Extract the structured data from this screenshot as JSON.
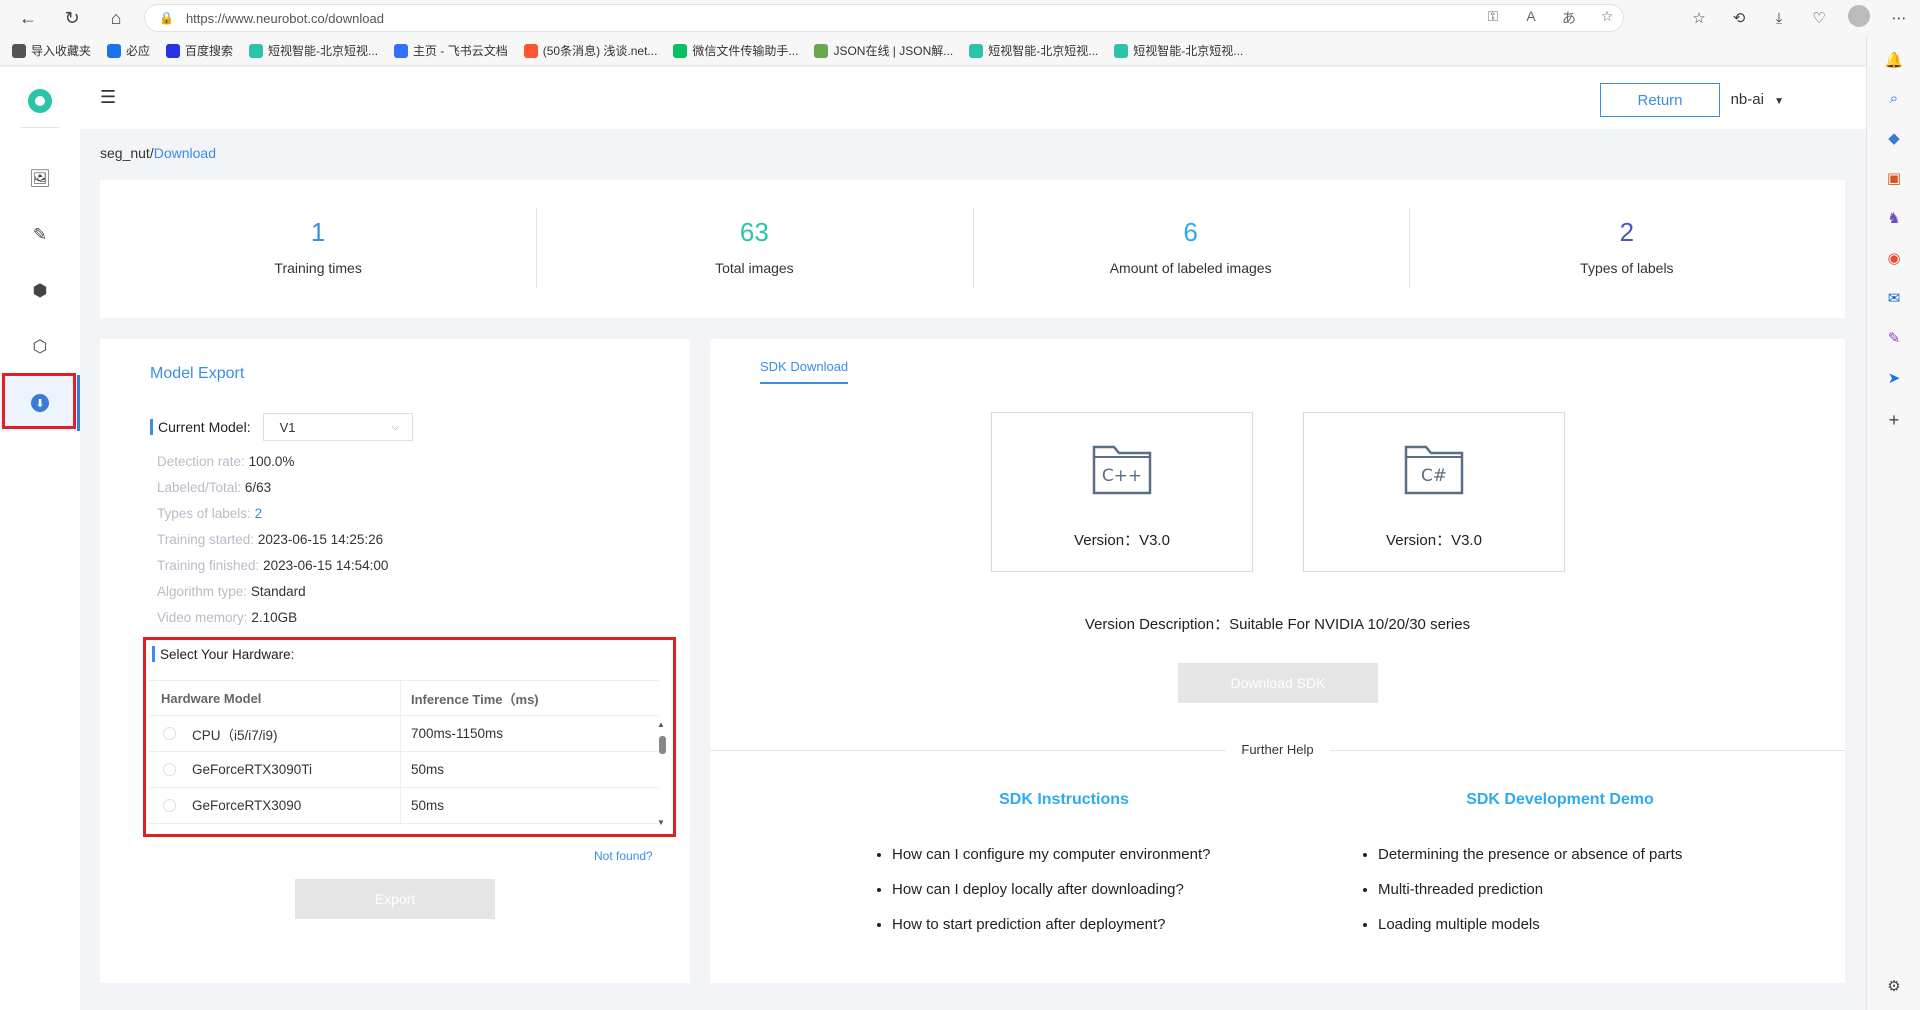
{
  "browser": {
    "url": "https://www.neurobot.co/download",
    "bookmarks": [
      {
        "label": "导入收藏夹",
        "color": "#555"
      },
      {
        "label": "必应",
        "color": "#1a73e8"
      },
      {
        "label": "百度搜索",
        "color": "#2932e1"
      },
      {
        "label": "短视智能-北京短视...",
        "color": "#2bc4a8"
      },
      {
        "label": "主页 - 飞书云文档",
        "color": "#3370ff"
      },
      {
        "label": "(50条消息) 浅谈.net...",
        "color": "#fc5531"
      },
      {
        "label": "微信文件传输助手...",
        "color": "#07c160"
      },
      {
        "label": "JSON在线 | JSON解...",
        "color": "#6aa84f"
      },
      {
        "label": "短视智能-北京短视...",
        "color": "#2bc4a8"
      },
      {
        "label": "短视智能-北京短视...",
        "color": "#2bc4a8"
      }
    ]
  },
  "header": {
    "return_label": "Return",
    "user": "nb-ai"
  },
  "breadcrumb": {
    "project": "seg_nut/",
    "current": "Download"
  },
  "stats": [
    {
      "value": "1",
      "label": "Training times",
      "color": "#3a8ee6"
    },
    {
      "value": "63",
      "label": "Total images",
      "color": "#2bc4a8"
    },
    {
      "value": "6",
      "label": "Amount of labeled images",
      "color": "#2eaaf0"
    },
    {
      "value": "2",
      "label": "Types of labels",
      "color": "#4a55c9"
    }
  ],
  "export": {
    "title": "Model Export",
    "current_model_label": "Current Model:",
    "current_model_value": "V1",
    "info": [
      {
        "key": "Detection rate:",
        "value": "100.0%"
      },
      {
        "key": "Labeled/Total:",
        "value": "6/63"
      },
      {
        "key": "Types of labels:",
        "value": "2"
      },
      {
        "key": "Training started:",
        "value": "2023-06-15 14:25:26"
      },
      {
        "key": "Training finished:",
        "value": "2023-06-15 14:54:00"
      },
      {
        "key": "Algorithm type:",
        "value": "Standard"
      },
      {
        "key": "Video memory:",
        "value": "2.10GB"
      }
    ],
    "hardware_title": "Select Your Hardware:",
    "table_headers": [
      "Hardware Model",
      "Inference Time（ms)"
    ],
    "rows": [
      {
        "model": "CPU（i5/i7/i9)",
        "time": "700ms-1150ms"
      },
      {
        "model": "GeForceRTX3090Ti",
        "time": "50ms"
      },
      {
        "model": "GeForceRTX3090",
        "time": "50ms"
      }
    ],
    "not_found": "Not found?",
    "export_label": "Export"
  },
  "sdk": {
    "tab": "SDK Download",
    "options": [
      {
        "lang": "C++",
        "version": "Version：V3.0"
      },
      {
        "lang": "C#",
        "version": "Version：V3.0"
      }
    ],
    "version_description": "Version Description：Suitable For NVIDIA 10/20/30 series",
    "download_label": "Download SDK",
    "further_help": "Further Help",
    "instructions_title": "SDK Instructions",
    "instructions": [
      "How can I configure my computer environment?",
      "How can I deploy locally after downloading?",
      "How to start prediction after deployment?"
    ],
    "demo_title": "SDK Development Demo",
    "demos": [
      "Determining the presence or absence of parts",
      "Multi-threaded prediction",
      "Loading multiple models"
    ]
  }
}
